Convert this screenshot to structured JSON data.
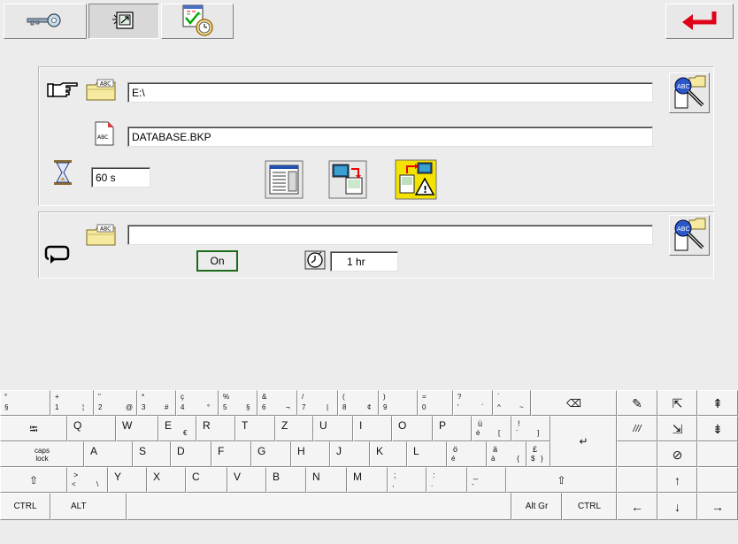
{
  "toolbar": {
    "key_icon": "key-icon",
    "backup_icon": "backup-disk-icon",
    "schedule_icon": "calendar-check-clock-icon",
    "return_icon": "return-arrow-icon"
  },
  "backup": {
    "folder_value": "E:\\",
    "file_value": "DATABASE.BKP",
    "timeout_value": "60 s"
  },
  "schedule": {
    "folder_value": "",
    "toggle_label": "On",
    "interval_value": "1 hr"
  },
  "keyboard": {
    "row1": [
      {
        "top": "°",
        "sub": "§"
      },
      {
        "top": "+",
        "sub": "1",
        "r": "¦"
      },
      {
        "top": "\"",
        "sub": "2",
        "r": "@"
      },
      {
        "top": "*",
        "sub": "3",
        "r": "#"
      },
      {
        "top": "ç",
        "sub": "4",
        "r": "°"
      },
      {
        "top": "%",
        "sub": "5",
        "r": "§"
      },
      {
        "top": "&",
        "sub": "6",
        "r": "¬"
      },
      {
        "top": "/",
        "sub": "7",
        "r": "|"
      },
      {
        "top": "(",
        "sub": "8",
        "r": "¢"
      },
      {
        "top": ")",
        "sub": "9"
      },
      {
        "top": "=",
        "sub": "0"
      },
      {
        "top": "?",
        "sub": "'",
        "r": "´"
      },
      {
        "top": "`",
        "sub": "^",
        "r": "~"
      }
    ],
    "backspace": "⌫",
    "row2": [
      {
        "k": "Q"
      },
      {
        "k": "W"
      },
      {
        "k": "E",
        "r": "€"
      },
      {
        "k": "R"
      },
      {
        "k": "T"
      },
      {
        "k": "Z"
      },
      {
        "k": "U"
      },
      {
        "k": "I"
      },
      {
        "k": "O"
      },
      {
        "k": "P"
      },
      {
        "k": "ü",
        "sub": "è",
        "r": "["
      },
      {
        "k": "!",
        "sub": "¨",
        "r": "]"
      }
    ],
    "tab": "⭾",
    "row3": [
      {
        "k": "A"
      },
      {
        "k": "S"
      },
      {
        "k": "D"
      },
      {
        "k": "F"
      },
      {
        "k": "G"
      },
      {
        "k": "H"
      },
      {
        "k": "J"
      },
      {
        "k": "K"
      },
      {
        "k": "L"
      },
      {
        "k": "ö",
        "sub": "é"
      },
      {
        "k": "ä",
        "sub": "à",
        "r": "{"
      },
      {
        "k": "£",
        "sub": "$",
        "r": "}"
      }
    ],
    "caps": "caps lock",
    "row4": [
      {
        "k": ">",
        "sub": "<",
        "r": "\\"
      },
      {
        "k": "Y"
      },
      {
        "k": "X"
      },
      {
        "k": "C"
      },
      {
        "k": "V"
      },
      {
        "k": "B"
      },
      {
        "k": "N"
      },
      {
        "k": "M"
      },
      {
        "k": ";",
        "sub": ","
      },
      {
        "k": ":",
        "sub": "."
      },
      {
        "k": "_",
        "sub": "-"
      }
    ],
    "shift": "⇧",
    "enter": "↵",
    "ctrl": "CTRL",
    "alt": "ALT",
    "altgr": "Alt Gr",
    "ctrl2": "CTRL",
    "side": {
      "a": "✎",
      "b": "⇱",
      "c": "⇞",
      "d": "///",
      "e": "⇲",
      "f": "⇟",
      "g": "⊘",
      "h": "↑",
      "i": "←",
      "j": "↓",
      "k": "→"
    }
  }
}
